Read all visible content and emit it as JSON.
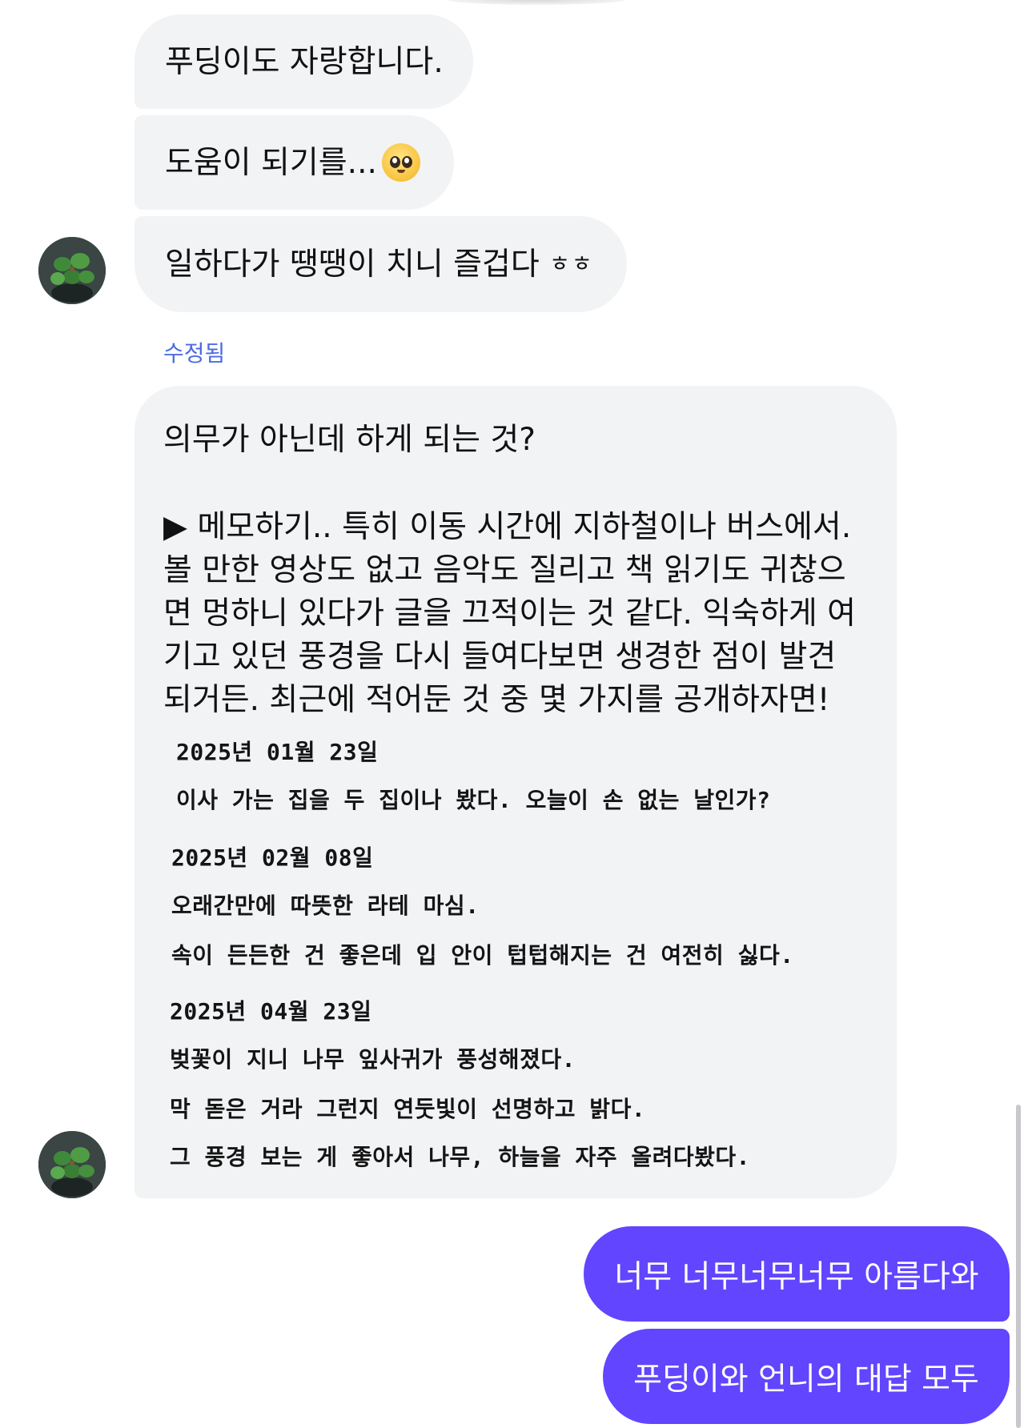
{
  "messages_in": {
    "m1": "푸딩이도 자랑합니다.",
    "m2": "도움이 되기를...",
    "m2_emoji": "pleading-face-icon",
    "m3": "일하다가 땡땡이 치니 즐겁다",
    "m3_suffix": "ㅎㅎ",
    "edited_label": "수정됨",
    "long": {
      "question": "의무가 아닌데 하게 되는 것?",
      "lines": [
        "▶ 메모하기.. 특히 이동 시간에 지하철이나 버스에서.",
        "볼 만한 영상도 없고 음악도 질리고 책 읽기도 귀찮으",
        "면 멍하니 있다가 글을 끄적이는 것 같다. 익숙하게 여",
        "기고 있던 풍경을 다시 들여다보면 생경한 점이 발견",
        "되거든. 최근에 적어둔 것 중 몇 가지를 공개하자면!"
      ],
      "memo": [
        "2025년 01월 23일",
        "이사 가는 집을 두 집이나 봤다. 오늘이 손 없는 날인가?",
        "2025년 02월 08일",
        "오래간만에 따뜻한 라테 마심.",
        "속이 든든한 건 좋은데 입 안이 텁텁해지는 건 여전히 싫다.",
        "2025년 04월 23일",
        "벚꽃이 지니 나무 잎사귀가 풍성해졌다.",
        "막 돋은 거라 그런지 연둣빛이 선명하고 밝다.",
        "그 풍경 보는 게 좋아서 나무, 하늘을 자주 올려다봤다."
      ]
    }
  },
  "messages_out": {
    "o1": "너무 너무너무너무 아름다와",
    "o2": "푸딩이와 언니의 대답 모두"
  },
  "colors": {
    "incoming_bubble": "#f2f3f5",
    "outgoing_bubble": "#6145ff",
    "edited_label": "#4d6be0"
  }
}
